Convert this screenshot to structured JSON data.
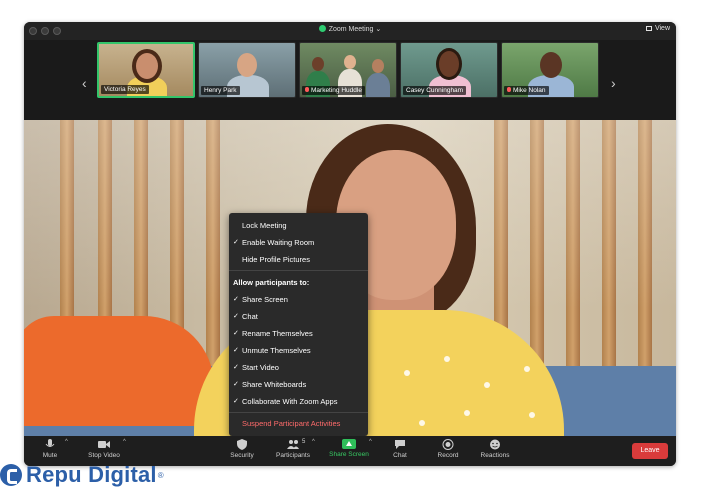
{
  "window": {
    "title": "Zoom Meeting",
    "view_label": "View"
  },
  "participants_strip": [
    {
      "name": "Victoria Reyes",
      "active": true,
      "muted": false
    },
    {
      "name": "Henry Park",
      "active": false,
      "muted": false
    },
    {
      "name": "Marketing Huddle",
      "active": false,
      "muted": true
    },
    {
      "name": "Casey Cunningham",
      "active": false,
      "muted": false
    },
    {
      "name": "Mike Nolan",
      "active": false,
      "muted": true
    }
  ],
  "security_menu": {
    "items": [
      {
        "label": "Lock Meeting",
        "checked": false
      },
      {
        "label": "Enable Waiting Room",
        "checked": true
      },
      {
        "label": "Hide Profile Pictures",
        "checked": false
      }
    ],
    "section_header": "Allow participants to:",
    "allow_items": [
      {
        "label": "Share Screen",
        "checked": true
      },
      {
        "label": "Chat",
        "checked": true
      },
      {
        "label": "Rename Themselves",
        "checked": true
      },
      {
        "label": "Unmute Themselves",
        "checked": true
      },
      {
        "label": "Start Video",
        "checked": true
      },
      {
        "label": "Share Whiteboards",
        "checked": true
      },
      {
        "label": "Collaborate With Zoom Apps",
        "checked": true
      }
    ],
    "suspend_label": "Suspend Participant Activities"
  },
  "toolbar": {
    "mute": "Mute",
    "stop_video": "Stop Video",
    "security": "Security",
    "participants": "Participants",
    "participants_count": "5",
    "share_screen": "Share Screen",
    "chat": "Chat",
    "record": "Record",
    "reactions": "Reactions",
    "leave": "Leave"
  },
  "brand": {
    "name": "Repu Digital",
    "mark": "®"
  },
  "colors": {
    "active_border": "#33c46a",
    "share_green": "#37c963",
    "leave_red": "#d93b3b",
    "danger_text": "#ff6b6b",
    "brand_blue": "#2c5fa8"
  }
}
